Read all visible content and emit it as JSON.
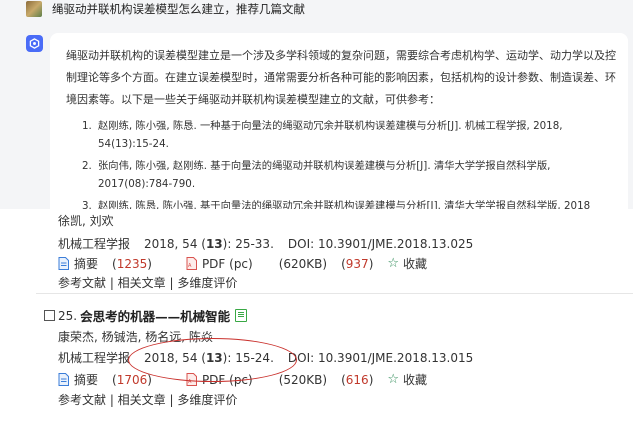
{
  "chat": {
    "question": "绳驱动并联机构误差模型怎么建立，推荐几篇文献",
    "intro": "绳驱动并联机构的误差模型建立是一个涉及多学科领域的复杂问题，需要综合考虑机构学、运动学、动力学以及控制理论等多个方面。在建立误差模型时，通常需要分析各种可能的影响因素，包括机构的设计参数、制造误差、环境因素等。以下是一些关于绳驱动并联机构误差模型建立的文献，可供参考：",
    "references": [
      {
        "num": "1.",
        "text": "赵刚练, 陈小强, 陈恳. 一种基于向量法的绳驱动冗余并联机构误差建模与分析[J]. 机械工程学报, 2018, 54(13):15-24."
      },
      {
        "num": "2.",
        "text": "张向伟, 陈小强, 赵刚练. 基于向量法的绳驱动并联机构误差建模与分析[J]. 清华大学学报自然科学版, 2017(08):784-790."
      },
      {
        "num": "3.",
        "text": "赵刚练, 陈恳, 陈小强. 基于向量法的绳驱动冗余并联机构误差建模与分析[J]. 清华大学学报自然科学版, 2018"
      }
    ]
  },
  "list": {
    "entry1": {
      "authors": "徐凯, 刘欢",
      "journal": "机械工程学报",
      "year_vol": "2018, 54 (",
      "issue": "13",
      "pages": "): 25-33.",
      "doi": "DOI: 10.3901/JME.2018.13.025",
      "abstract_label": "摘要",
      "abstract_count": "1235",
      "pdf_label": "PDF (pc)",
      "pdf_size": "(620KB)",
      "pdf_count": "937",
      "favorite_label": "收藏",
      "links": "参考文献 | 相关文章 | 多维度评价"
    },
    "entry2": {
      "number": "25.",
      "title": "会思考的机器——机械智能",
      "authors": "康荣杰, 杨铖浩, 杨名远, 陈焱",
      "journal": "机械工程学报",
      "year_vol": "2018, 54 (",
      "issue": "13",
      "pages": "): 15-24.",
      "doi": "DOI: 10.3901/JME.2018.13.015",
      "abstract_label": "摘要",
      "abstract_count": "1706",
      "pdf_label": "PDF (pc)",
      "pdf_size": "(520KB)",
      "pdf_count": "616",
      "favorite_label": "收藏",
      "links": "参考文献 | 相关文章 | 多维度评价"
    }
  },
  "colors": {
    "accent": "#4a6cf7",
    "count_red": "#c0392b",
    "annotation_red": "#c9302c",
    "favorite_green": "#2e8b57",
    "doc_blue": "#3b7dd8"
  }
}
